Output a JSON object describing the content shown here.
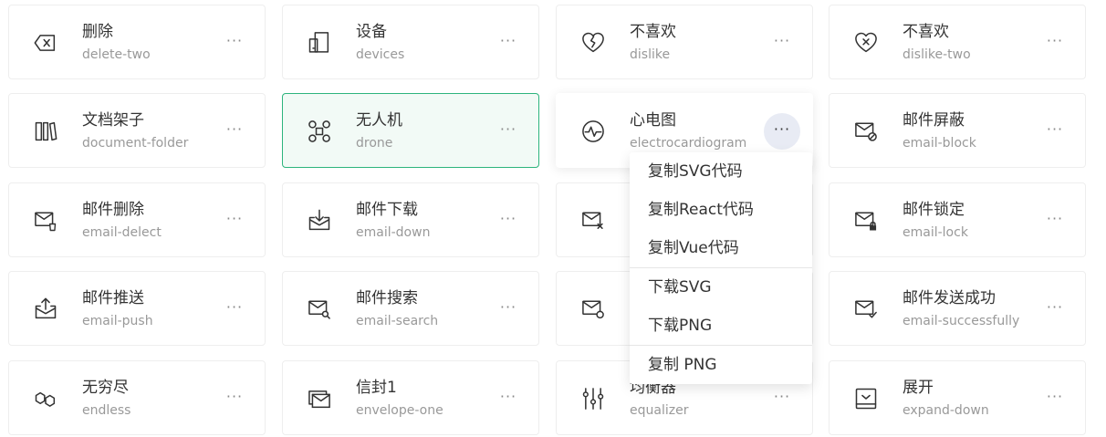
{
  "cards": [
    {
      "cn": "删除",
      "en": "delete-two",
      "icon": "delete-two-icon"
    },
    {
      "cn": "设备",
      "en": "devices",
      "icon": "devices-icon"
    },
    {
      "cn": "不喜欢",
      "en": "dislike",
      "icon": "dislike-icon"
    },
    {
      "cn": "不喜欢",
      "en": "dislike-two",
      "icon": "dislike-two-icon"
    },
    {
      "cn": "文档架子",
      "en": "document-folder",
      "icon": "document-folder-icon"
    },
    {
      "cn": "无人机",
      "en": "drone",
      "icon": "drone-icon",
      "selected": true
    },
    {
      "cn": "心电图",
      "en": "electrocardiogram",
      "icon": "electrocardiogram-icon",
      "hovered": true
    },
    {
      "cn": "邮件屏蔽",
      "en": "email-block",
      "icon": "email-block-icon"
    },
    {
      "cn": "邮件删除",
      "en": "email-delect",
      "icon": "email-delect-icon"
    },
    {
      "cn": "邮件下载",
      "en": "email-down",
      "icon": "email-down-icon"
    },
    {
      "cn": "",
      "en": "",
      "icon": "email-fail-icon"
    },
    {
      "cn": "邮件锁定",
      "en": "email-lock",
      "icon": "email-lock-icon"
    },
    {
      "cn": "邮件推送",
      "en": "email-push",
      "icon": "email-push-icon"
    },
    {
      "cn": "邮件搜索",
      "en": "email-search",
      "icon": "email-search-icon"
    },
    {
      "cn": "",
      "en": "",
      "icon": "email-security-icon"
    },
    {
      "cn": "邮件发送成功",
      "en": "email-successfully",
      "icon": "email-successfully-icon"
    },
    {
      "cn": "无穷尽",
      "en": "endless",
      "icon": "endless-icon"
    },
    {
      "cn": "信封1",
      "en": "envelope-one",
      "icon": "envelope-one-icon"
    },
    {
      "cn": "均衡器",
      "en": "equalizer",
      "icon": "equalizer-icon"
    },
    {
      "cn": "展开",
      "en": "expand-down",
      "icon": "expand-down-icon"
    }
  ],
  "more_label": "···",
  "menu": {
    "items": [
      "复制SVG代码",
      "复制React代码",
      "复制Vue代码",
      "下载SVG",
      "下载PNG",
      "复制 PNG"
    ]
  },
  "colors": {
    "selected_border": "#2db47d",
    "selected_bg": "#f2faf6",
    "active_more_bg": "#e8ebf4"
  }
}
